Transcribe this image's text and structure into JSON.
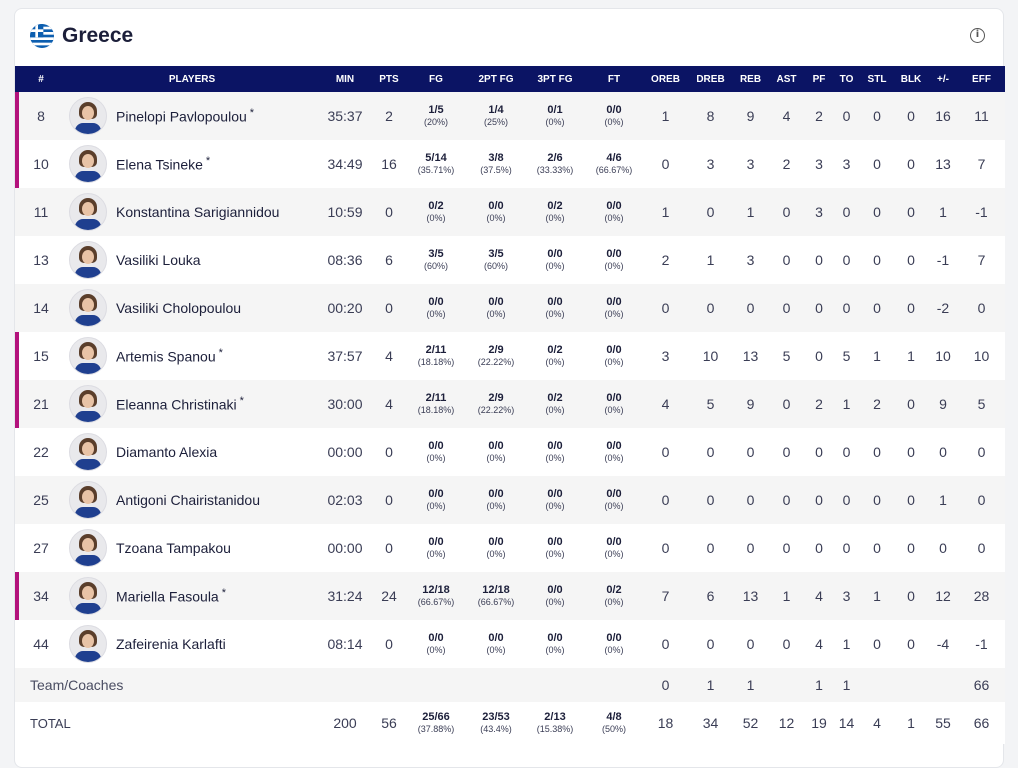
{
  "team": {
    "name": "Greece",
    "flag_icon": "greece-flag-icon",
    "info_icon": "info-icon"
  },
  "columns": [
    "#",
    "PLAYERS",
    "MIN",
    "PTS",
    "FG",
    "2PT FG",
    "3PT FG",
    "FT",
    "OREB",
    "DREB",
    "REB",
    "AST",
    "PF",
    "TO",
    "STL",
    "BLK",
    "+/-",
    "EFF"
  ],
  "starter_marker": "*",
  "colors": {
    "header_bg": "#0b1464",
    "starter_bar": "#b3127c"
  },
  "players": [
    {
      "num": "8",
      "name": "Pinelopi Pavlopoulou",
      "starter": true,
      "min": "35:37",
      "pts": "2",
      "fg": "1/5",
      "fg_pct": "(20%)",
      "fg2": "1/4",
      "fg2_pct": "(25%)",
      "fg3": "0/1",
      "fg3_pct": "(0%)",
      "ft": "0/0",
      "ft_pct": "(0%)",
      "oreb": "1",
      "dreb": "8",
      "reb": "9",
      "ast": "4",
      "pf": "2",
      "to": "0",
      "stl": "0",
      "blk": "0",
      "pm": "16",
      "eff": "11"
    },
    {
      "num": "10",
      "name": "Elena Tsineke",
      "starter": true,
      "min": "34:49",
      "pts": "16",
      "fg": "5/14",
      "fg_pct": "(35.71%)",
      "fg2": "3/8",
      "fg2_pct": "(37.5%)",
      "fg3": "2/6",
      "fg3_pct": "(33.33%)",
      "ft": "4/6",
      "ft_pct": "(66.67%)",
      "oreb": "0",
      "dreb": "3",
      "reb": "3",
      "ast": "2",
      "pf": "3",
      "to": "3",
      "stl": "0",
      "blk": "0",
      "pm": "13",
      "eff": "7"
    },
    {
      "num": "11",
      "name": "Konstantina Sarigiannidou",
      "starter": false,
      "min": "10:59",
      "pts": "0",
      "fg": "0/2",
      "fg_pct": "(0%)",
      "fg2": "0/0",
      "fg2_pct": "(0%)",
      "fg3": "0/2",
      "fg3_pct": "(0%)",
      "ft": "0/0",
      "ft_pct": "(0%)",
      "oreb": "1",
      "dreb": "0",
      "reb": "1",
      "ast": "0",
      "pf": "3",
      "to": "0",
      "stl": "0",
      "blk": "0",
      "pm": "1",
      "eff": "-1"
    },
    {
      "num": "13",
      "name": "Vasiliki Louka",
      "starter": false,
      "min": "08:36",
      "pts": "6",
      "fg": "3/5",
      "fg_pct": "(60%)",
      "fg2": "3/5",
      "fg2_pct": "(60%)",
      "fg3": "0/0",
      "fg3_pct": "(0%)",
      "ft": "0/0",
      "ft_pct": "(0%)",
      "oreb": "2",
      "dreb": "1",
      "reb": "3",
      "ast": "0",
      "pf": "0",
      "to": "0",
      "stl": "0",
      "blk": "0",
      "pm": "-1",
      "eff": "7"
    },
    {
      "num": "14",
      "name": "Vasiliki Cholopoulou",
      "starter": false,
      "min": "00:20",
      "pts": "0",
      "fg": "0/0",
      "fg_pct": "(0%)",
      "fg2": "0/0",
      "fg2_pct": "(0%)",
      "fg3": "0/0",
      "fg3_pct": "(0%)",
      "ft": "0/0",
      "ft_pct": "(0%)",
      "oreb": "0",
      "dreb": "0",
      "reb": "0",
      "ast": "0",
      "pf": "0",
      "to": "0",
      "stl": "0",
      "blk": "0",
      "pm": "-2",
      "eff": "0"
    },
    {
      "num": "15",
      "name": "Artemis Spanou",
      "starter": true,
      "min": "37:57",
      "pts": "4",
      "fg": "2/11",
      "fg_pct": "(18.18%)",
      "fg2": "2/9",
      "fg2_pct": "(22.22%)",
      "fg3": "0/2",
      "fg3_pct": "(0%)",
      "ft": "0/0",
      "ft_pct": "(0%)",
      "oreb": "3",
      "dreb": "10",
      "reb": "13",
      "ast": "5",
      "pf": "0",
      "to": "5",
      "stl": "1",
      "blk": "1",
      "pm": "10",
      "eff": "10"
    },
    {
      "num": "21",
      "name": "Eleanna Christinaki",
      "starter": true,
      "min": "30:00",
      "pts": "4",
      "fg": "2/11",
      "fg_pct": "(18.18%)",
      "fg2": "2/9",
      "fg2_pct": "(22.22%)",
      "fg3": "0/2",
      "fg3_pct": "(0%)",
      "ft": "0/0",
      "ft_pct": "(0%)",
      "oreb": "4",
      "dreb": "5",
      "reb": "9",
      "ast": "0",
      "pf": "2",
      "to": "1",
      "stl": "2",
      "blk": "0",
      "pm": "9",
      "eff": "5"
    },
    {
      "num": "22",
      "name": "Diamanto Alexia",
      "starter": false,
      "min": "00:00",
      "pts": "0",
      "fg": "0/0",
      "fg_pct": "(0%)",
      "fg2": "0/0",
      "fg2_pct": "(0%)",
      "fg3": "0/0",
      "fg3_pct": "(0%)",
      "ft": "0/0",
      "ft_pct": "(0%)",
      "oreb": "0",
      "dreb": "0",
      "reb": "0",
      "ast": "0",
      "pf": "0",
      "to": "0",
      "stl": "0",
      "blk": "0",
      "pm": "0",
      "eff": "0"
    },
    {
      "num": "25",
      "name": "Antigoni Chairistanidou",
      "starter": false,
      "min": "02:03",
      "pts": "0",
      "fg": "0/0",
      "fg_pct": "(0%)",
      "fg2": "0/0",
      "fg2_pct": "(0%)",
      "fg3": "0/0",
      "fg3_pct": "(0%)",
      "ft": "0/0",
      "ft_pct": "(0%)",
      "oreb": "0",
      "dreb": "0",
      "reb": "0",
      "ast": "0",
      "pf": "0",
      "to": "0",
      "stl": "0",
      "blk": "0",
      "pm": "1",
      "eff": "0"
    },
    {
      "num": "27",
      "name": "Tzoana Tampakou",
      "starter": false,
      "min": "00:00",
      "pts": "0",
      "fg": "0/0",
      "fg_pct": "(0%)",
      "fg2": "0/0",
      "fg2_pct": "(0%)",
      "fg3": "0/0",
      "fg3_pct": "(0%)",
      "ft": "0/0",
      "ft_pct": "(0%)",
      "oreb": "0",
      "dreb": "0",
      "reb": "0",
      "ast": "0",
      "pf": "0",
      "to": "0",
      "stl": "0",
      "blk": "0",
      "pm": "0",
      "eff": "0"
    },
    {
      "num": "34",
      "name": "Mariella Fasoula",
      "starter": true,
      "min": "31:24",
      "pts": "24",
      "fg": "12/18",
      "fg_pct": "(66.67%)",
      "fg2": "12/18",
      "fg2_pct": "(66.67%)",
      "fg3": "0/0",
      "fg3_pct": "(0%)",
      "ft": "0/2",
      "ft_pct": "(0%)",
      "oreb": "7",
      "dreb": "6",
      "reb": "13",
      "ast": "1",
      "pf": "4",
      "to": "3",
      "stl": "1",
      "blk": "0",
      "pm": "12",
      "eff": "28"
    },
    {
      "num": "44",
      "name": "Zafeirenia Karlafti",
      "starter": false,
      "min": "08:14",
      "pts": "0",
      "fg": "0/0",
      "fg_pct": "(0%)",
      "fg2": "0/0",
      "fg2_pct": "(0%)",
      "fg3": "0/0",
      "fg3_pct": "(0%)",
      "ft": "0/0",
      "ft_pct": "(0%)",
      "oreb": "0",
      "dreb": "0",
      "reb": "0",
      "ast": "0",
      "pf": "4",
      "to": "1",
      "stl": "0",
      "blk": "0",
      "pm": "-4",
      "eff": "-1"
    }
  ],
  "team_row": {
    "label": "Team/Coaches",
    "oreb": "0",
    "dreb": "1",
    "reb": "1",
    "ast": "",
    "pf": "1",
    "to": "1",
    "stl": "",
    "blk": "",
    "pm": "",
    "eff": "66"
  },
  "total_row": {
    "label": "TOTAL",
    "min": "200",
    "pts": "56",
    "fg": "25/66",
    "fg_pct": "(37.88%)",
    "fg2": "23/53",
    "fg2_pct": "(43.4%)",
    "fg3": "2/13",
    "fg3_pct": "(15.38%)",
    "ft": "4/8",
    "ft_pct": "(50%)",
    "oreb": "18",
    "dreb": "34",
    "reb": "52",
    "ast": "12",
    "pf": "19",
    "to": "14",
    "stl": "4",
    "blk": "1",
    "pm": "55",
    "eff": "66"
  }
}
